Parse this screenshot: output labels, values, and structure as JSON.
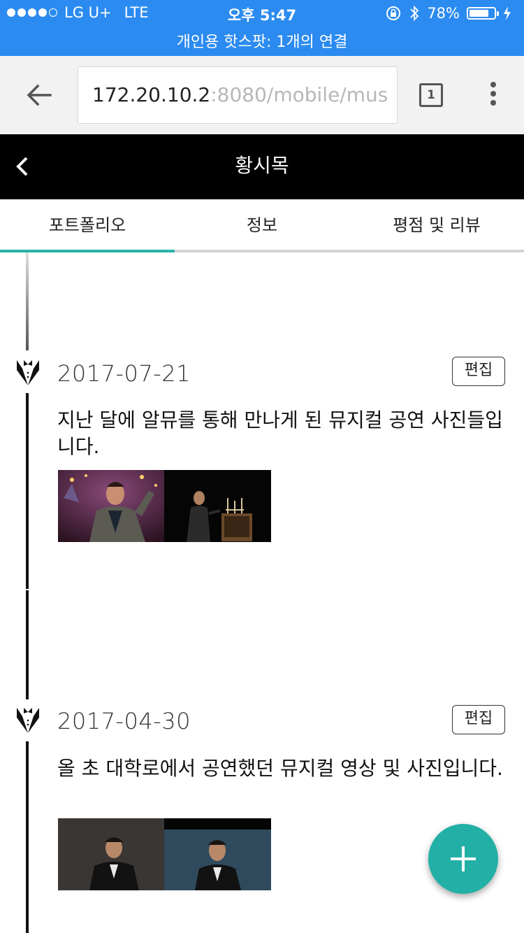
{
  "status_bar": {
    "carrier": "LG U+",
    "network": "LTE",
    "time": "오후 5:47",
    "battery_percent": "78%",
    "battery_level": 0.78,
    "hotspot_text": "개인용 핫스팟: 1개의 연결",
    "signal_bars_filled": 4,
    "signal_bars_total": 5
  },
  "browser": {
    "url_host": "172.20.10.2",
    "url_path": ":8080/mobile/mus",
    "tab_count": "1"
  },
  "header": {
    "title": "황시목"
  },
  "tabs": [
    {
      "label": "포트폴리오",
      "active": true
    },
    {
      "label": "정보",
      "active": false
    },
    {
      "label": "평점 및 리뷰",
      "active": false
    }
  ],
  "timeline": [
    {
      "date": "2017-07-21",
      "edit_label": "편집",
      "description": "지난 달에 알뮤를 통해 만나게 된 뮤지컬 공연 사진들입니다.",
      "photos": [
        "performer-singing-photo",
        "performer-stage-table-photo"
      ]
    },
    {
      "date": "2017-04-30",
      "edit_label": "편집",
      "description": "올 초 대학로에서 공연했던 뮤지컬 영상 및 사진입니다.",
      "photos": [
        "performer-stage-photo-1",
        "performer-stage-photo-2"
      ]
    }
  ],
  "colors": {
    "status_bar": "#2b8bf0",
    "accent": "#2cb2a8",
    "fab": "#22b0a6",
    "header": "#000000"
  },
  "icons": {
    "back": "arrow-left-icon",
    "header_back": "chevron-left-icon",
    "entry_marker": "tuxedo-icon",
    "fab": "plus-icon"
  }
}
